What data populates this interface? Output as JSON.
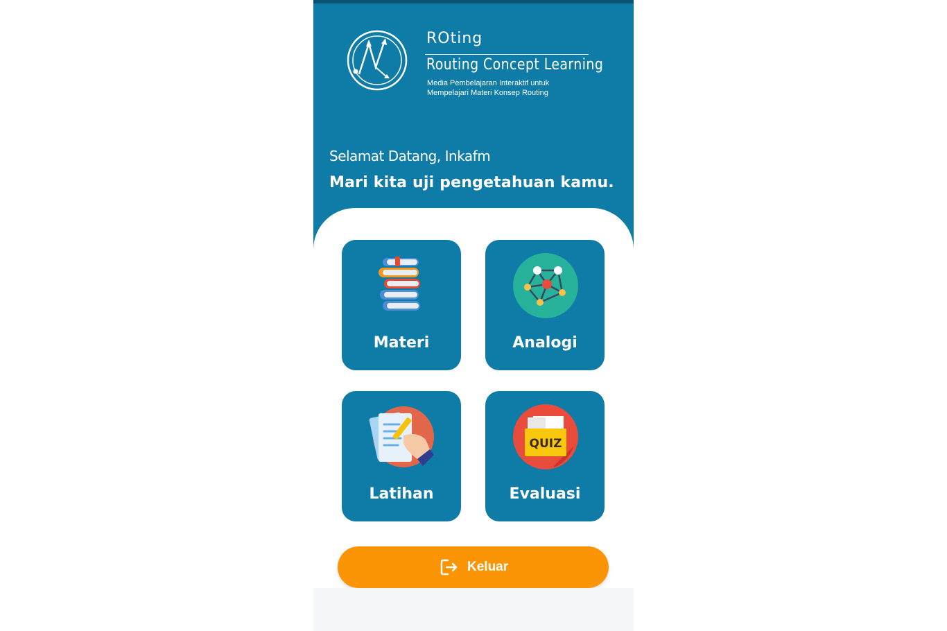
{
  "brand": {
    "short": "ROting",
    "title": "Routing Concept Learning",
    "subtitle_line1": "Media Pembelajaran Interaktif untuk",
    "subtitle_line2": "Mempelajari Materi Konsep Routing"
  },
  "greeting": {
    "welcome": "Selamat Datang, Inkafm",
    "tagline": "Mari kita uji pengetahuan kamu."
  },
  "menu": [
    {
      "label": "Materi",
      "icon": "books-icon"
    },
    {
      "label": "Analogi",
      "icon": "network-icon"
    },
    {
      "label": "Latihan",
      "icon": "writing-exercise-icon"
    },
    {
      "label": "Evaluasi",
      "icon": "quiz-folder-icon"
    }
  ],
  "logout": {
    "label": "Keluar",
    "icon": "logout-icon"
  },
  "colors": {
    "primary": "#0f7ba7",
    "accent": "#fc9505",
    "background": "#ffffff"
  }
}
